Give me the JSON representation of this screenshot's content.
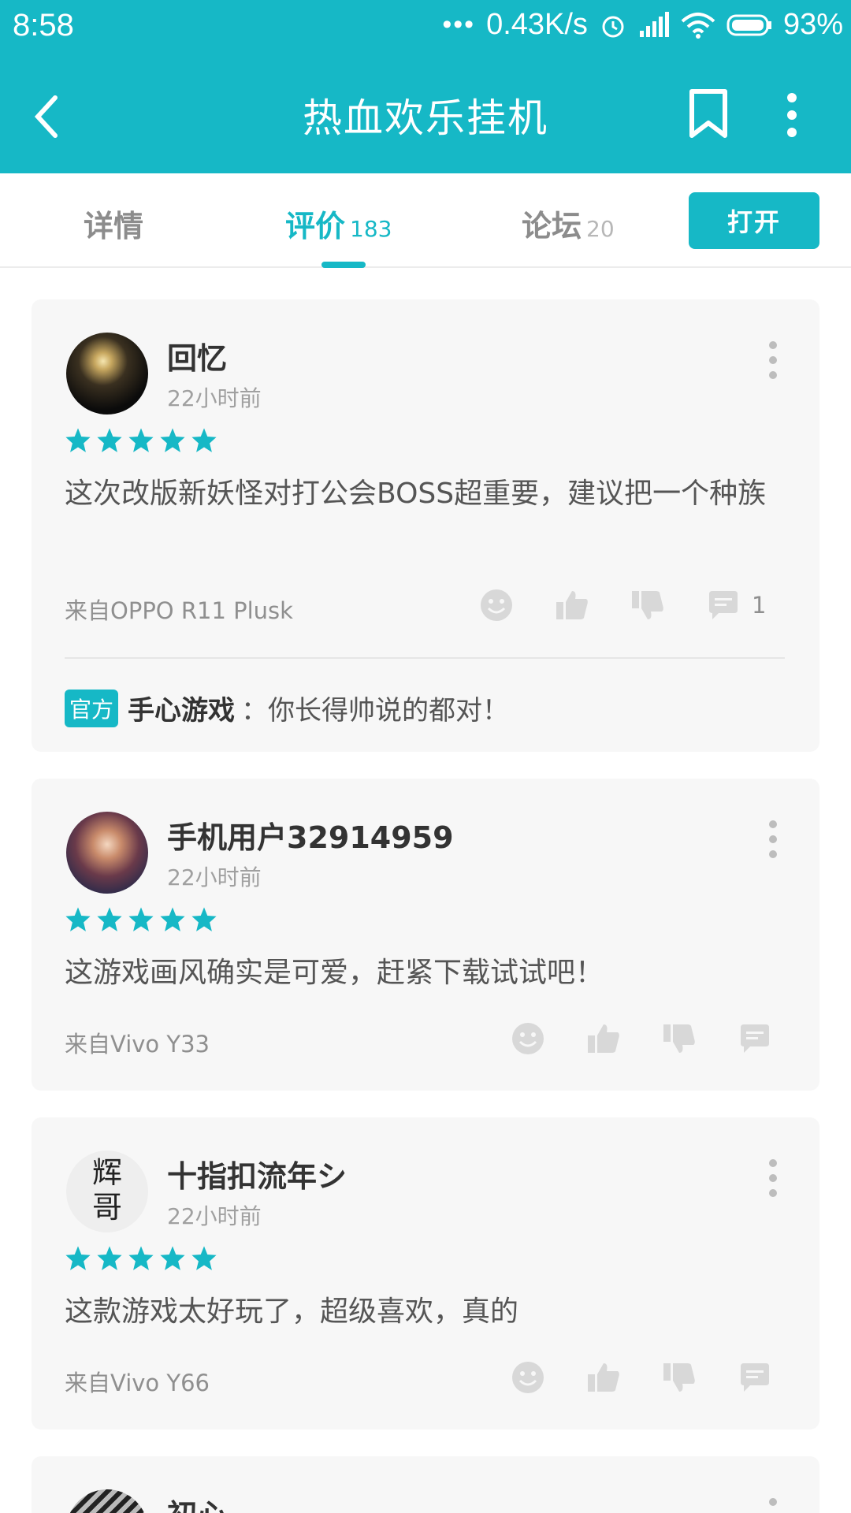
{
  "status": {
    "time": "8:58",
    "speed": "0.43K/s",
    "battery": "93%"
  },
  "appbar": {
    "title": "热血欢乐挂机"
  },
  "tabs": {
    "details": "详情",
    "reviews": "评价",
    "reviews_count": "183",
    "forum": "论坛",
    "forum_count": "20",
    "open_button": "打开"
  },
  "reviews": [
    {
      "name": "回忆",
      "time": "22小时前",
      "stars": 5,
      "text": "这次改版新妖怪对打公会BOSS超重要，建议把一个种族",
      "device": "来自OPPO R11 Plusk",
      "reply_count": "1",
      "official_badge": "官方",
      "official_name": "手心游戏",
      "official_reply": "：你长得帅说的都对！"
    },
    {
      "name": "手机用户32914959",
      "time": "22小时前",
      "stars": 5,
      "text": "这游戏画风确实是可爱，赶紧下载试试吧！",
      "device": "来自Vivo Y33"
    },
    {
      "name": "十指扣流年シ",
      "time": "22小时前",
      "stars": 5,
      "text": "这款游戏太好玩了，超级喜欢，真的",
      "device": "来自Vivo Y66"
    },
    {
      "name": "初心"
    }
  ],
  "colors": {
    "accent": "#16b8c6",
    "card_bg": "#f7f7f7"
  }
}
